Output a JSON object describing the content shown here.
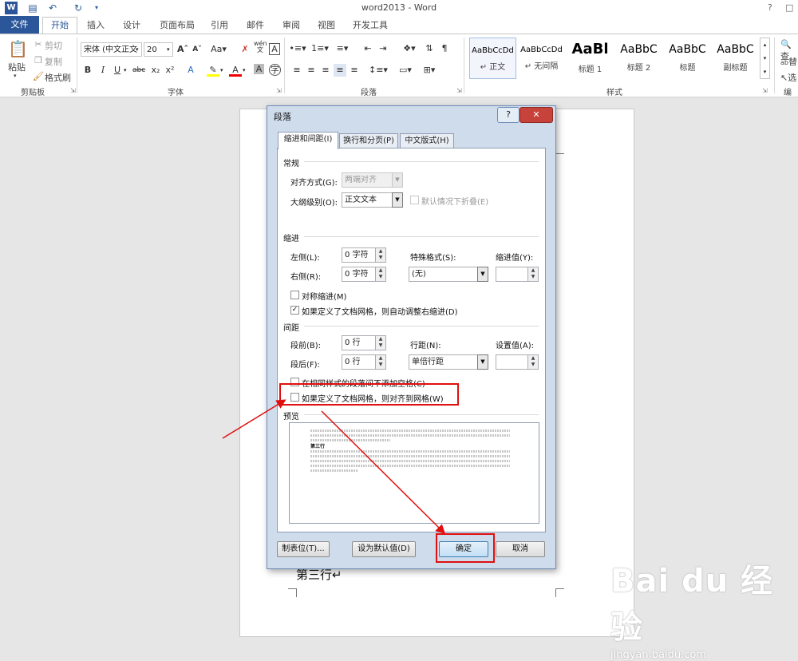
{
  "window": {
    "title": "word2013 - Word",
    "help": "?"
  },
  "tabs": [
    "文件",
    "开始",
    "插入",
    "设计",
    "页面布局",
    "引用",
    "邮件",
    "审阅",
    "视图",
    "开发工具"
  ],
  "ribbon": {
    "clipboard": {
      "label": "剪贴板",
      "paste": "粘贴",
      "cut": "剪切",
      "copy": "复制",
      "format_painter": "格式刷"
    },
    "font": {
      "label": "字体",
      "font_name": "宋体 (中文正文",
      "font_size": "20"
    },
    "paragraph": {
      "label": "段落"
    },
    "styles": {
      "label": "样式",
      "items": [
        {
          "sample": "AaBbCcDd",
          "name": "↵ 正文"
        },
        {
          "sample": "AaBbCcDd",
          "name": "↵ 无间隔"
        },
        {
          "sample": "AaBl",
          "name": "标题 1"
        },
        {
          "sample": "AaBbC",
          "name": "标题 2"
        },
        {
          "sample": "AaBbC",
          "name": "标题"
        },
        {
          "sample": "AaBbC",
          "name": "副标题"
        }
      ]
    },
    "editing": {
      "find": "查",
      "replace": "替",
      "select": "选",
      "label": "编"
    }
  },
  "document": {
    "line3": "第三行↵"
  },
  "dialog": {
    "title": "段落",
    "tabs": [
      "缩进和间距(I)",
      "换行和分页(P)",
      "中文版式(H)"
    ],
    "general": {
      "section": "常规",
      "alignment_label": "对齐方式(G):",
      "alignment_value": "两端对齐",
      "outline_label": "大纲级别(O):",
      "outline_value": "正文文本",
      "collapse_label": "默认情况下折叠(E)"
    },
    "indent": {
      "section": "缩进",
      "left_label": "左侧(L):",
      "left_value": "0 字符",
      "right_label": "右侧(R):",
      "right_value": "0 字符",
      "special_label": "特殊格式(S):",
      "special_value": "(无)",
      "by_label": "缩进值(Y):",
      "mirror_label": "对称缩进(M)",
      "auto_adjust_label": "如果定义了文档网格，则自动调整右缩进(D)",
      "auto_adjust_checked": "✓"
    },
    "spacing": {
      "section": "间距",
      "before_label": "段前(B):",
      "before_value": "0 行",
      "after_label": "段后(F):",
      "after_value": "0 行",
      "line_label": "行距(N):",
      "line_value": "单倍行距",
      "at_label": "设置值(A):",
      "no_space_label": "在相同样式的段落间不添加空格(C)",
      "snap_grid_label": "如果定义了文档网格，则对齐到网格(W)"
    },
    "preview": {
      "section": "预览",
      "sample_text": "第三行"
    },
    "buttons": {
      "tabs": "制表位(T)...",
      "default": "设为默认值(D)",
      "ok": "确定",
      "cancel": "取消"
    }
  },
  "watermark": {
    "brand": "Bai du 经验",
    "url": "jingyan.baidu.com"
  }
}
